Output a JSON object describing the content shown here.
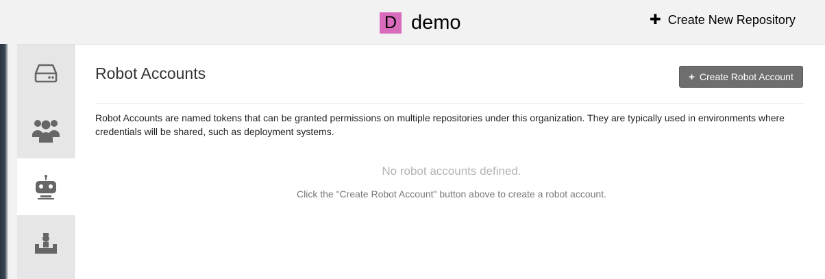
{
  "header": {
    "org_initial": "D",
    "org_name": "demo",
    "avatar_color": "#d96bbd",
    "create_repo_icon": "plus-icon",
    "create_repo_label": "Create New Repository"
  },
  "sidebar": {
    "items": [
      {
        "icon": "hard-drive-icon",
        "active": false
      },
      {
        "icon": "users-icon",
        "active": false
      },
      {
        "icon": "robot-icon",
        "active": true
      },
      {
        "icon": "user-desk-icon",
        "active": false
      }
    ]
  },
  "main": {
    "title": "Robot Accounts",
    "create_button_label": "Create Robot Account",
    "description": "Robot Accounts are named tokens that can be granted permissions on multiple repositories under this organization. They are typically used in environments where credentials will be shared, such as deployment systems.",
    "empty_title": "No robot accounts defined.",
    "empty_hint": "Click the \"Create Robot Account\" button above to create a robot account."
  },
  "colors": {
    "button_bg": "#6e6e6e",
    "sidebar_bg": "#e6e6e6",
    "icon_color": "#666666"
  }
}
